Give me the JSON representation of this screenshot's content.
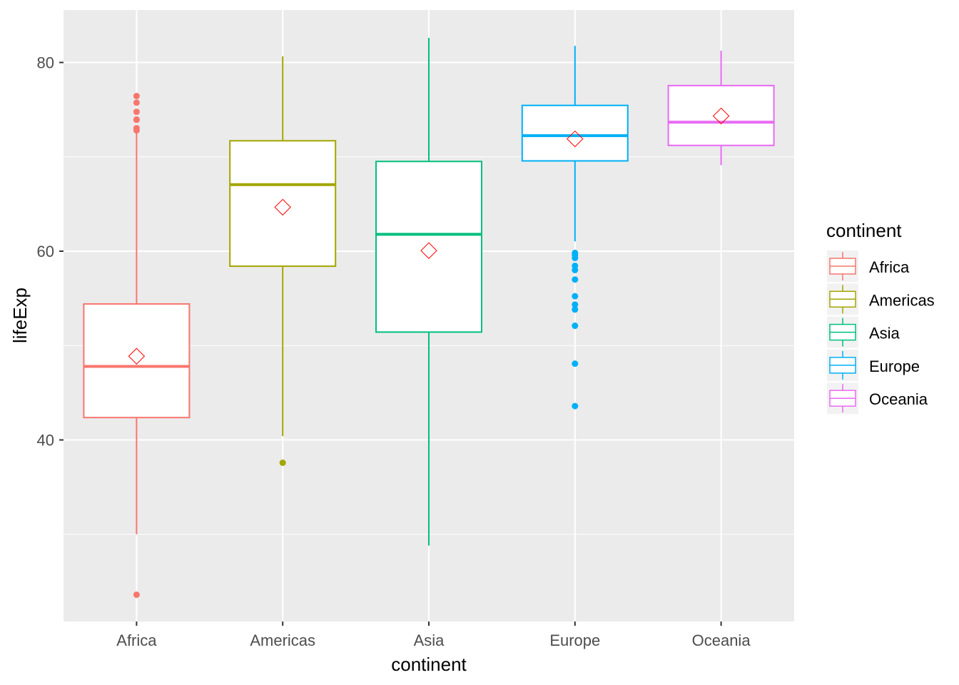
{
  "chart_data": {
    "type": "boxplot",
    "xlabel": "continent",
    "ylabel": "lifeExp",
    "ylim": [
      20.76,
      85.56
    ],
    "yticks": [
      40,
      60,
      80
    ],
    "categories": [
      "Africa",
      "Americas",
      "Asia",
      "Europe",
      "Oceania"
    ],
    "grid": true,
    "legend": {
      "title": "continent",
      "position": "right",
      "entries": [
        "Africa",
        "Americas",
        "Asia",
        "Europe",
        "Oceania"
      ]
    },
    "colors": [
      "#F8766D",
      "#A3A500",
      "#00BF7D",
      "#00B0F6",
      "#E76BF3"
    ],
    "mean_marker_color": "#FF0000",
    "boxes": [
      {
        "name": "Africa",
        "whisker_low": 30.0,
        "q1": 42.37,
        "median": 47.79,
        "q3": 54.41,
        "whisker_high": 72.8,
        "mean": 48.87,
        "outliers": [
          23.6,
          72.8,
          73.04,
          73.92,
          73.95,
          74.77,
          75.74,
          76.44
        ]
      },
      {
        "name": "Americas",
        "whisker_low": 40.41,
        "q1": 58.41,
        "median": 67.05,
        "q3": 71.7,
        "whisker_high": 80.65,
        "mean": 64.66,
        "outliers": [
          37.58
        ]
      },
      {
        "name": "Asia",
        "whisker_low": 28.8,
        "q1": 51.43,
        "median": 61.79,
        "q3": 69.51,
        "whisker_high": 82.6,
        "mean": 60.06,
        "outliers": []
      },
      {
        "name": "Europe",
        "whisker_low": 61.04,
        "q1": 69.57,
        "median": 72.24,
        "q3": 75.45,
        "whisker_high": 81.76,
        "mean": 71.9,
        "outliers": [
          43.59,
          48.08,
          52.1,
          53.82,
          54.34,
          55.23,
          57.0,
          58.0,
          58.45,
          59.28,
          59.6,
          59.82
        ]
      },
      {
        "name": "Oceania",
        "whisker_low": 69.12,
        "q1": 71.21,
        "median": 73.67,
        "q3": 77.55,
        "whisker_high": 81.24,
        "mean": 74.33,
        "outliers": []
      }
    ]
  }
}
